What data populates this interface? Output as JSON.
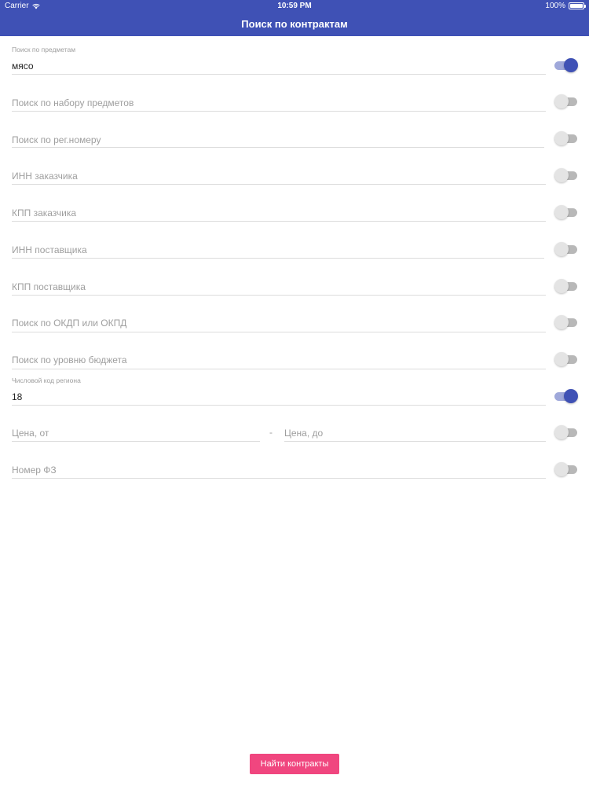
{
  "status_bar": {
    "carrier": "Carrier",
    "time": "10:59 PM",
    "battery": "100%"
  },
  "header": {
    "title": "Поиск по контрактам",
    "color": "#3f51b5"
  },
  "fields": {
    "subjects": {
      "label": "Поиск по предметам",
      "value": "мясо",
      "enabled": true
    },
    "subject_set": {
      "placeholder": "Поиск по набору предметов",
      "enabled": false
    },
    "reg_number": {
      "placeholder": "Поиск по рег.номеру",
      "enabled": false
    },
    "customer_inn": {
      "placeholder": "ИНН заказчика",
      "enabled": false
    },
    "customer_kpp": {
      "placeholder": "КПП заказчика",
      "enabled": false
    },
    "supplier_inn": {
      "placeholder": "ИНН поставщика",
      "enabled": false
    },
    "supplier_kpp": {
      "placeholder": "КПП поставщика",
      "enabled": false
    },
    "okdp": {
      "placeholder": "Поиск по ОКДП или ОКПД",
      "enabled": false
    },
    "budget": {
      "placeholder": "Поиск по уровню бюджета",
      "enabled": false
    },
    "region": {
      "label": "Числовой код региона",
      "value": "18",
      "enabled": true
    },
    "price": {
      "from_placeholder": "Цена, от",
      "separator": "-",
      "to_placeholder": "Цена, до",
      "enabled": false
    },
    "fz": {
      "placeholder": "Номер ФЗ",
      "enabled": false
    }
  },
  "actions": {
    "search_label": "Найти контракты",
    "search_color": "#f0467f"
  }
}
